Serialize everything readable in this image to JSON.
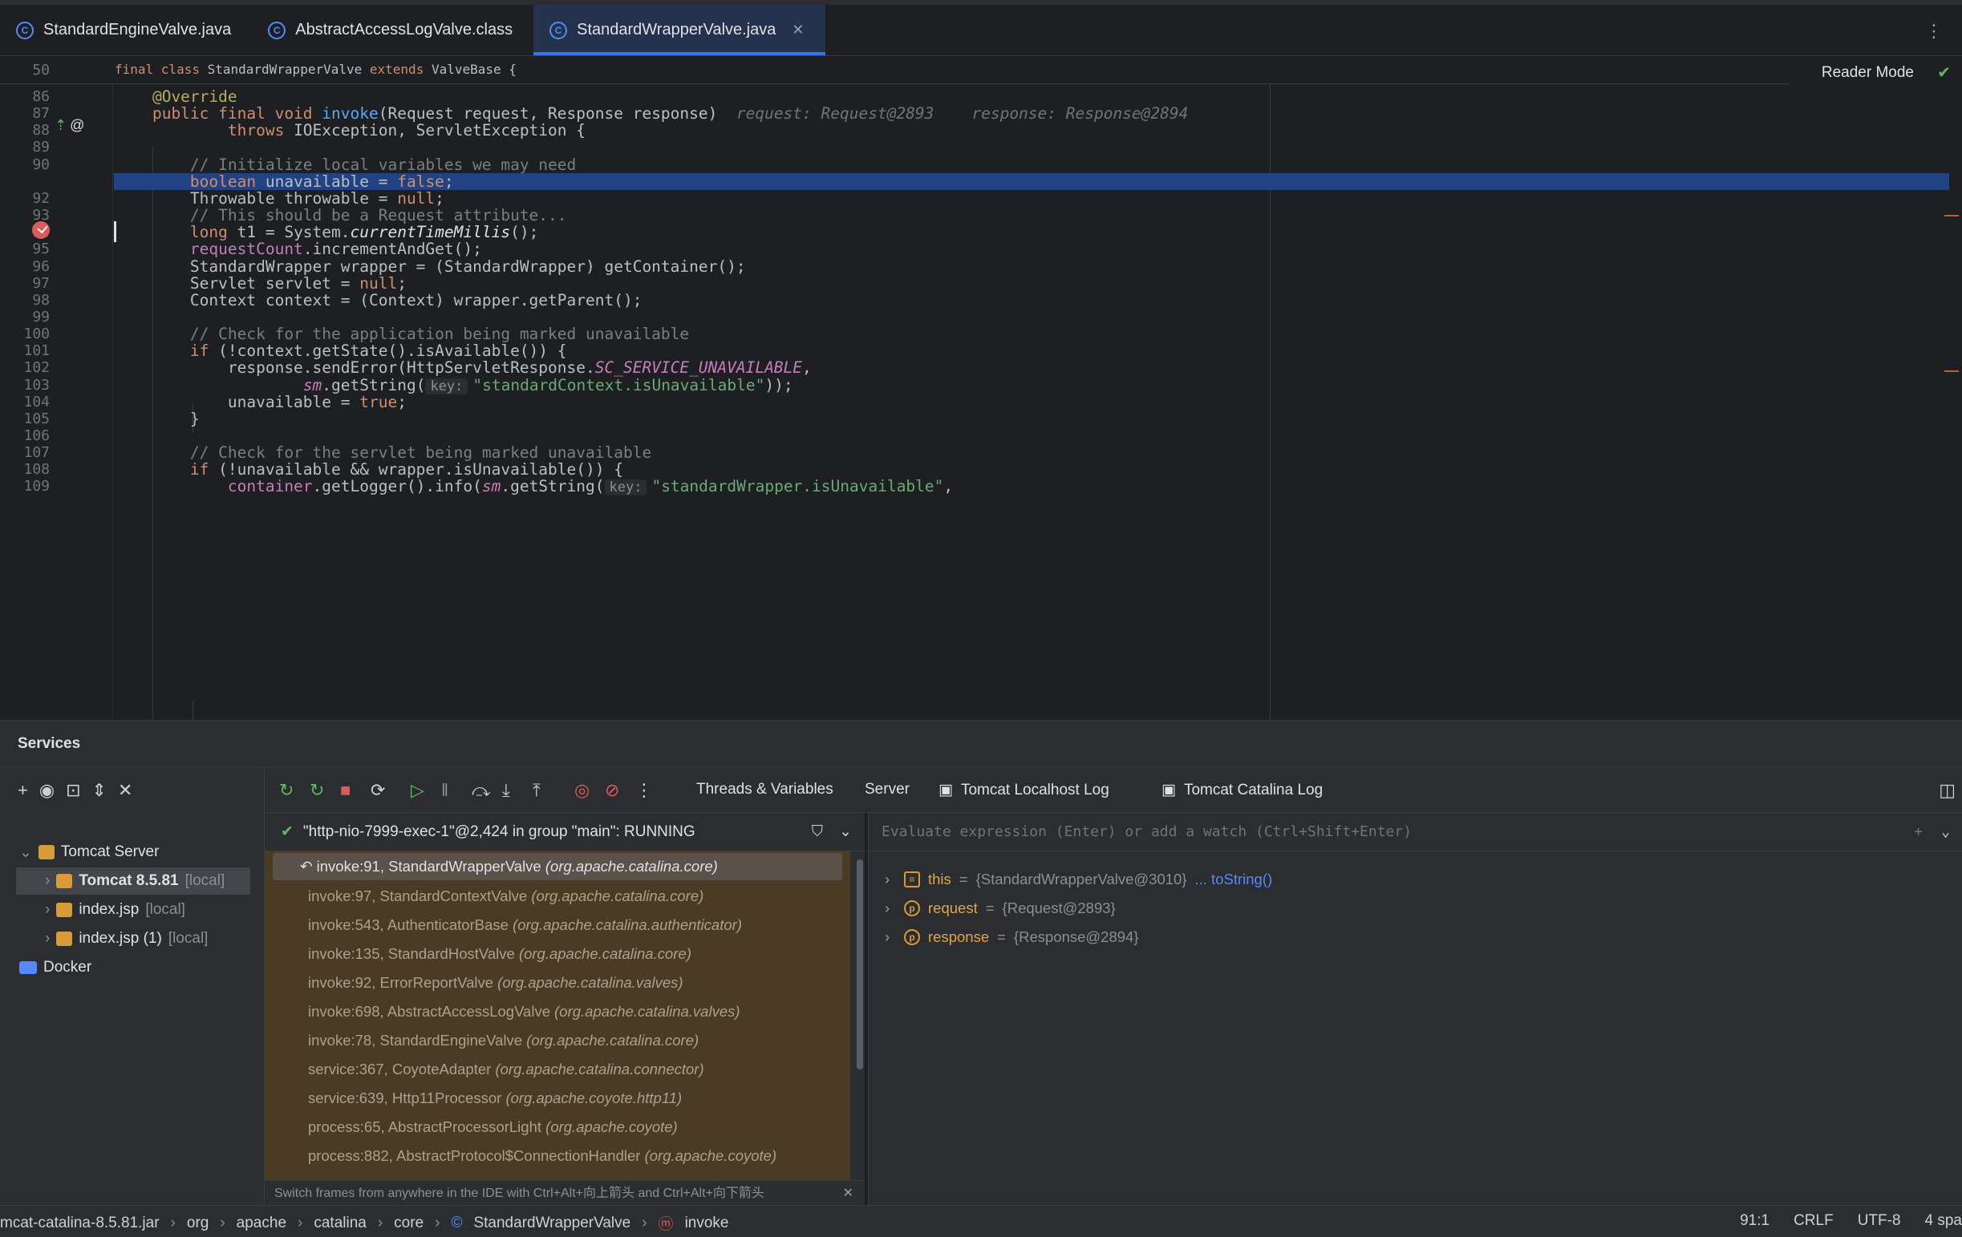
{
  "tabs": [
    {
      "label": "StandardEngineValve.java",
      "active": false
    },
    {
      "label": "AbstractAccessLogValve.class",
      "active": false
    },
    {
      "label": "StandardWrapperValve.java",
      "active": true
    }
  ],
  "editor": {
    "reader_mode": "Reader Mode",
    "sticky": {
      "num": "50",
      "tokens": [
        [
          "kw",
          "final class "
        ],
        [
          "txt",
          "StandardWrapperValve "
        ],
        [
          "kw",
          "extends "
        ],
        [
          "txt",
          "ValveBase {"
        ]
      ]
    },
    "lines": [
      {
        "num": "86",
        "tokens": [
          [
            "ann",
            "    @Override"
          ]
        ]
      },
      {
        "num": "87",
        "tokens": [
          [
            "kw",
            "    public final void "
          ],
          [
            "fn",
            "invoke"
          ],
          [
            "txt",
            "(Request request, Response response)"
          ],
          [
            "inl",
            "  request: Request@2893    response: Response@2894"
          ]
        ]
      },
      {
        "num": "88",
        "tokens": [
          [
            "kw",
            "            throws "
          ],
          [
            "txt",
            "IOException, ServletException {"
          ]
        ]
      },
      {
        "num": "89",
        "tokens": []
      },
      {
        "num": "90",
        "tokens": [
          [
            "cmt",
            "        // Initialize local variables we may need"
          ]
        ]
      },
      {
        "num": "",
        "tokens": [
          [
            "kw",
            "        boolean "
          ],
          [
            "txt",
            "unavailable = "
          ],
          [
            "kw",
            "false"
          ],
          [
            "txt",
            ";"
          ]
        ],
        "hl": true
      },
      {
        "num": "92",
        "tokens": [
          [
            "txt",
            "        Throwable throwable = "
          ],
          [
            "kw",
            "null"
          ],
          [
            "txt",
            ";"
          ]
        ]
      },
      {
        "num": "93",
        "tokens": [
          [
            "cmt",
            "        // This should be a Request attribute..."
          ]
        ]
      },
      {
        "num": "94",
        "tokens": [
          [
            "kw",
            "        long "
          ],
          [
            "txt",
            "t1 = System."
          ],
          [
            "it",
            "currentTimeMillis"
          ],
          [
            "txt",
            "();"
          ]
        ]
      },
      {
        "num": "95",
        "tokens": [
          [
            "fld",
            "        requestCount"
          ],
          [
            "txt",
            ".incrementAndGet();"
          ]
        ]
      },
      {
        "num": "96",
        "tokens": [
          [
            "txt",
            "        StandardWrapper wrapper = (StandardWrapper) getContainer();"
          ]
        ]
      },
      {
        "num": "97",
        "tokens": [
          [
            "txt",
            "        Servlet servlet = "
          ],
          [
            "kw",
            "null"
          ],
          [
            "txt",
            ";"
          ]
        ]
      },
      {
        "num": "98",
        "tokens": [
          [
            "txt",
            "        Context context = (Context) wrapper.getParent();"
          ]
        ]
      },
      {
        "num": "99",
        "tokens": []
      },
      {
        "num": "100",
        "tokens": [
          [
            "cmt",
            "        // Check for the application being marked unavailable"
          ]
        ]
      },
      {
        "num": "101",
        "tokens": [
          [
            "kw",
            "        if "
          ],
          [
            "txt",
            "(!context.getState().isAvailable()) {"
          ]
        ]
      },
      {
        "num": "102",
        "tokens": [
          [
            "txt",
            "            response.sendError(HttpServletResponse."
          ],
          [
            "itf",
            "SC_SERVICE_UNAVAILABLE"
          ],
          [
            "txt",
            ","
          ]
        ]
      },
      {
        "num": "103",
        "tokens": [
          [
            "txt",
            "                    "
          ],
          [
            "itf",
            "sm"
          ],
          [
            "txt",
            ".getString("
          ],
          [
            "hint",
            "key:"
          ],
          [
            "str",
            "\"standardContext.isUnavailable\""
          ],
          [
            "txt",
            "));"
          ]
        ]
      },
      {
        "num": "104",
        "tokens": [
          [
            "txt",
            "            unavailable = "
          ],
          [
            "kw",
            "true"
          ],
          [
            "txt",
            ";"
          ]
        ]
      },
      {
        "num": "105",
        "tokens": [
          [
            "txt",
            "        }"
          ]
        ]
      },
      {
        "num": "106",
        "tokens": []
      },
      {
        "num": "107",
        "tokens": [
          [
            "cmt",
            "        // Check for the servlet being marked unavailable"
          ]
        ]
      },
      {
        "num": "108",
        "tokens": [
          [
            "kw",
            "        if "
          ],
          [
            "txt",
            "(!unavailable && wrapper.isUnavailable()) {"
          ]
        ]
      },
      {
        "num": "109",
        "tokens": [
          [
            "fld",
            "            container"
          ],
          [
            "txt",
            ".getLogger().info("
          ],
          [
            "itf",
            "sm"
          ],
          [
            "txt",
            ".getString("
          ],
          [
            "hint",
            "key:"
          ],
          [
            "str",
            "\"standardWrapper.isUnavailable\""
          ],
          [
            "txt",
            ","
          ]
        ]
      }
    ]
  },
  "services": {
    "title": "Services",
    "tree": [
      {
        "label": "Tomcat Server",
        "suffix": "",
        "level": 0,
        "selected": false,
        "bold": false
      },
      {
        "label": "Tomcat 8.5.81",
        "suffix": "[local]",
        "level": 1,
        "selected": true,
        "bold": true
      },
      {
        "label": "index.jsp",
        "suffix": "[local]",
        "level": 1,
        "selected": false,
        "bold": false
      },
      {
        "label": "index.jsp (1)",
        "suffix": "[local]",
        "level": 1,
        "selected": false,
        "bold": false
      },
      {
        "label": "Docker",
        "suffix": "",
        "level": 0,
        "selected": false,
        "bold": false
      }
    ]
  },
  "debug": {
    "tabs": [
      "Threads & Variables",
      "Server",
      "Tomcat Localhost Log",
      "Tomcat Catalina Log"
    ],
    "thread": "\"http-nio-7999-exec-1\"@2,424 in group \"main\": RUNNING",
    "frames": [
      {
        "m": "invoke:91, StandardWrapperValve",
        "p": "(org.apache.catalina.core)"
      },
      {
        "m": "invoke:97, StandardContextValve",
        "p": "(org.apache.catalina.core)"
      },
      {
        "m": "invoke:543, AuthenticatorBase",
        "p": "(org.apache.catalina.authenticator)"
      },
      {
        "m": "invoke:135, StandardHostValve",
        "p": "(org.apache.catalina.core)"
      },
      {
        "m": "invoke:92, ErrorReportValve",
        "p": "(org.apache.catalina.valves)"
      },
      {
        "m": "invoke:698, AbstractAccessLogValve",
        "p": "(org.apache.catalina.valves)"
      },
      {
        "m": "invoke:78, StandardEngineValve",
        "p": "(org.apache.catalina.core)"
      },
      {
        "m": "service:367, CoyoteAdapter",
        "p": "(org.apache.catalina.connector)"
      },
      {
        "m": "service:639, Http11Processor",
        "p": "(org.apache.coyote.http11)"
      },
      {
        "m": "process:65, AbstractProcessorLight",
        "p": "(org.apache.coyote)"
      },
      {
        "m": "process:882, AbstractProtocol$ConnectionHandler",
        "p": "(org.apache.coyote)"
      }
    ],
    "hint": "Switch frames from anywhere in the IDE with Ctrl+Alt+向上箭头 and Ctrl+Alt+向下箭头",
    "eval_placeholder": "Evaluate expression (Enter) or add a watch (Ctrl+Shift+Enter)",
    "vars": [
      {
        "name": "this",
        "value": "{StandardWrapperValve@3010}",
        "link": "... toString()"
      },
      {
        "name": "request",
        "value": "{Request@2893}",
        "link": ""
      },
      {
        "name": "response",
        "value": "{Response@2894}",
        "link": ""
      }
    ]
  },
  "status": {
    "crumbs": [
      "mcat-catalina-8.5.81.jar",
      "org",
      "apache",
      "catalina",
      "core",
      "StandardWrapperValve",
      "invoke"
    ],
    "position": "91:1",
    "line_sep": "CRLF",
    "encoding": "UTF-8",
    "indent": "4 spa"
  }
}
